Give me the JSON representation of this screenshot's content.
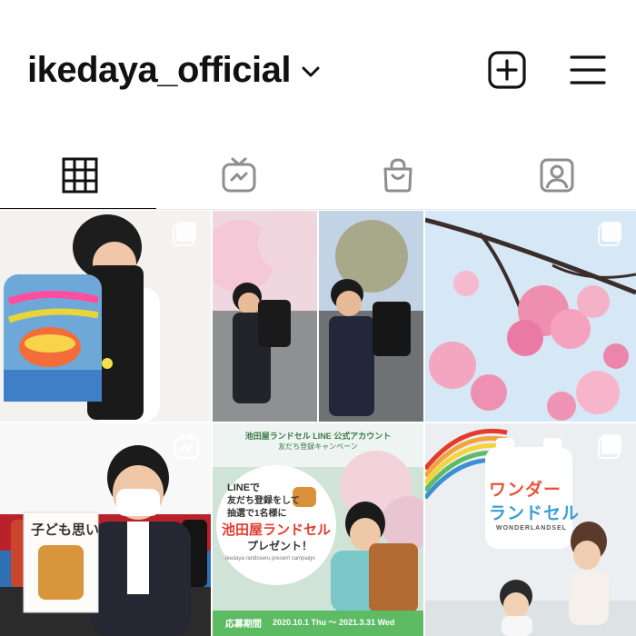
{
  "header": {
    "username": "ikedaya_official",
    "icons": {
      "dropdown": "chevron-down-icon",
      "new_post": "plus-square-icon",
      "menu": "hamburger-menu-icon"
    }
  },
  "tabs": [
    {
      "name": "grid",
      "icon": "grid-icon",
      "active": true
    },
    {
      "name": "igtv",
      "icon": "igtv-icon",
      "active": false
    },
    {
      "name": "shop",
      "icon": "shopping-bag-icon",
      "active": false
    },
    {
      "name": "tagged",
      "icon": "tagged-person-icon",
      "active": false
    }
  ],
  "posts": [
    {
      "subject": "child with painted school backpack",
      "badge": "carousel-icon"
    },
    {
      "subject": "boys with school backpacks under cherry blossoms",
      "badge": null
    },
    {
      "subject": "pink cherry blossoms",
      "badge": "carousel-icon"
    },
    {
      "subject": "man in mask holding brochure",
      "badge": "igtv-icon",
      "brochure_text": "子ども思い"
    },
    {
      "subject": "LINE campaign banner",
      "badge": null,
      "top_line1": "池田屋ランドセル LINE 公式アカウント",
      "top_line2": "友だち登録キャンペーン",
      "bubble_line1": "LINEで",
      "bubble_line2": "友だち登録をして",
      "bubble_line3": "抽選で1名様に",
      "bubble_title": "池田屋ランドセル",
      "bubble_title2": "プレゼント！",
      "bubble_small": "ikedaya randoseru present campaign",
      "period_label": "応募期間",
      "period": "2020.10.1 Thu ～ 2021.3.31 Wed"
    },
    {
      "subject": "Wonder Randsel poster",
      "badge": "carousel-icon",
      "poster_line1": "ワンダー",
      "poster_line2": "ランドセル",
      "poster_en": "WONDERLANDSEL"
    }
  ],
  "colors": {
    "text": "#111111",
    "icon_gray": "#8e8e8e",
    "campaign_green": "#5dbb63",
    "campaign_red": "#e33b2e"
  }
}
